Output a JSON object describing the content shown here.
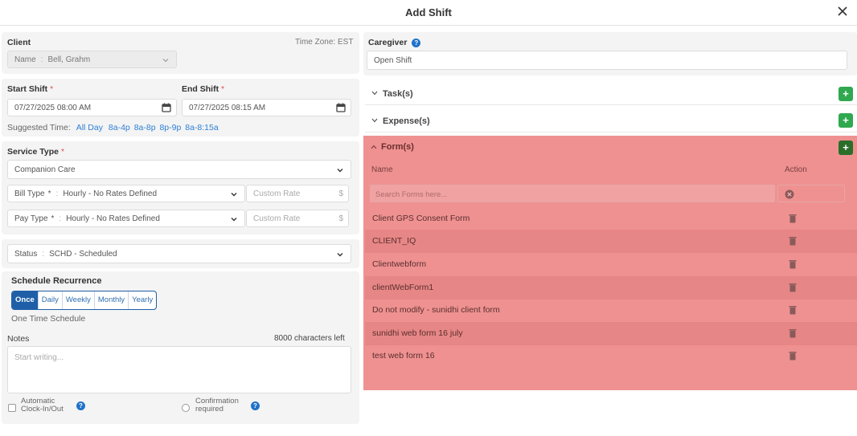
{
  "window": {
    "title": "Add Shift"
  },
  "client": {
    "label": "Client",
    "timezone": "Time Zone: EST",
    "name_prefix": "Name",
    "name_value": "Bell, Grahm"
  },
  "shift": {
    "start_label": "Start Shift",
    "end_label": "End Shift",
    "required_mark": "*",
    "start_value": "07/27/2025 08:00 AM",
    "end_value": "07/27/2025 08:15 AM",
    "suggested_label": "Suggested Time:",
    "suggested_options": [
      "All Day",
      "8a-4p",
      "8a-8p",
      "8p-9p",
      "8a-8:15a"
    ]
  },
  "service": {
    "label": "Service Type",
    "value": "Companion Care",
    "bill_type_label": "Bill Type",
    "bill_type_value": "Hourly - No Rates Defined",
    "pay_type_label": "Pay Type",
    "pay_type_value": "Hourly - No Rates Defined",
    "custom_rate_placeholder": "Custom Rate",
    "currency": "$"
  },
  "status": {
    "label": "Status",
    "value": "SCHD - Scheduled"
  },
  "recurrence": {
    "label": "Schedule Recurrence",
    "options": [
      "Once",
      "Daily",
      "Weekly",
      "Monthly",
      "Yearly"
    ],
    "active": "Once",
    "description": "One Time Schedule"
  },
  "notes": {
    "label": "Notes",
    "counter": "8000 characters left",
    "placeholder": "Start writing..."
  },
  "options": {
    "auto_clock_line1": "Automatic",
    "auto_clock_line2": "Clock-In/Out",
    "confirm_line1": "Confirmation",
    "confirm_line2": "required"
  },
  "caregiver": {
    "label": "Caregiver",
    "value": "Open Shift"
  },
  "tasks": {
    "label": "Task(s)"
  },
  "expenses": {
    "label": "Expense(s)"
  },
  "forms": {
    "label": "Form(s)",
    "col_name": "Name",
    "col_action": "Action",
    "search_placeholder": "Search Forms here...",
    "items": [
      "Client GPS Consent Form",
      "CLIENT_IQ",
      "Clientwebform",
      "clientWebForm1",
      "Do not modify - sunidhi client form",
      "sunidhi web form 16 july",
      "test web form 16"
    ]
  },
  "colors": {
    "forms_highlight": "#ef9191",
    "add_button": "#2fa84f",
    "accent_blue": "#1f5fa8"
  }
}
